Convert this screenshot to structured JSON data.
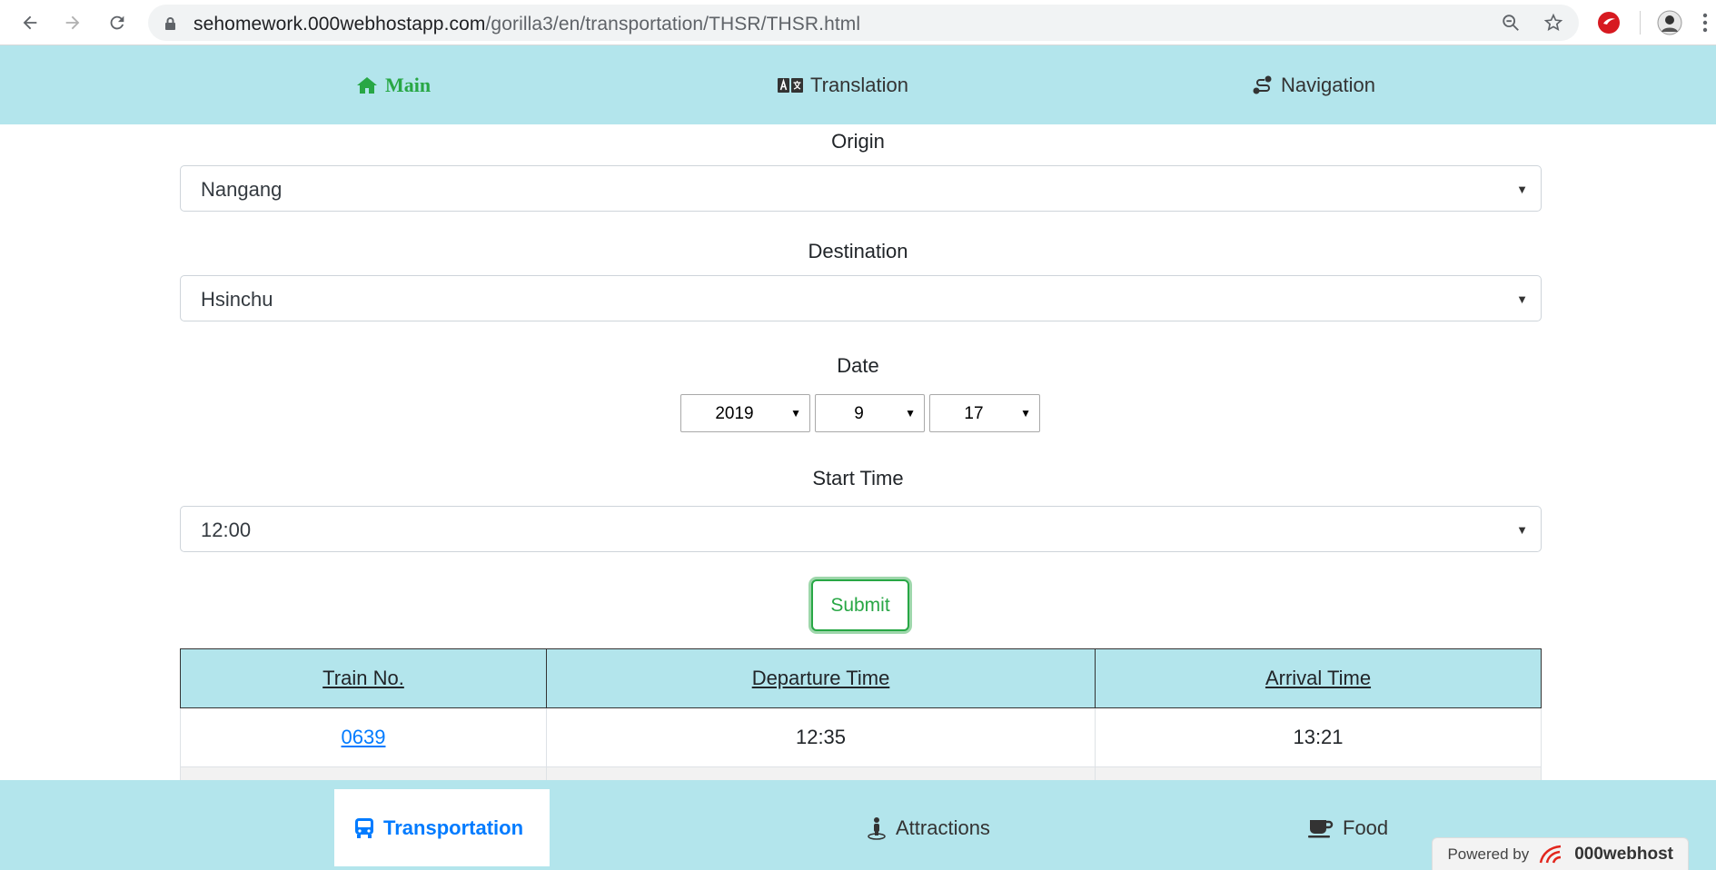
{
  "browser": {
    "url_host": "sehomework.000webhostapp.com",
    "url_path": "/gorilla3/en/transportation/THSR/THSR.html"
  },
  "topnav": {
    "main": "Main",
    "translation": "Translation",
    "navigation": "Navigation"
  },
  "form": {
    "origin_label": "Origin",
    "origin_value": "Nangang",
    "destination_label": "Destination",
    "destination_value": "Hsinchu",
    "date_label": "Date",
    "year": "2019",
    "month": "9",
    "day": "17",
    "start_time_label": "Start Time",
    "start_time_value": "12:00",
    "submit_label": "Submit"
  },
  "table": {
    "headers": [
      "Train No.",
      "Departure Time",
      "Arrival Time"
    ],
    "rows": [
      {
        "train_no": "0639",
        "departure": "12:35",
        "arrival": "13:21"
      }
    ]
  },
  "bottomnav": {
    "transportation": "Transportation",
    "attractions": "Attractions",
    "food": "Food"
  },
  "footer": {
    "powered_by": "Powered by",
    "brand": "000webhost"
  },
  "colors": {
    "nav_bg": "#b3e5ec",
    "active_green": "#28a745",
    "active_blue": "#007bff"
  }
}
